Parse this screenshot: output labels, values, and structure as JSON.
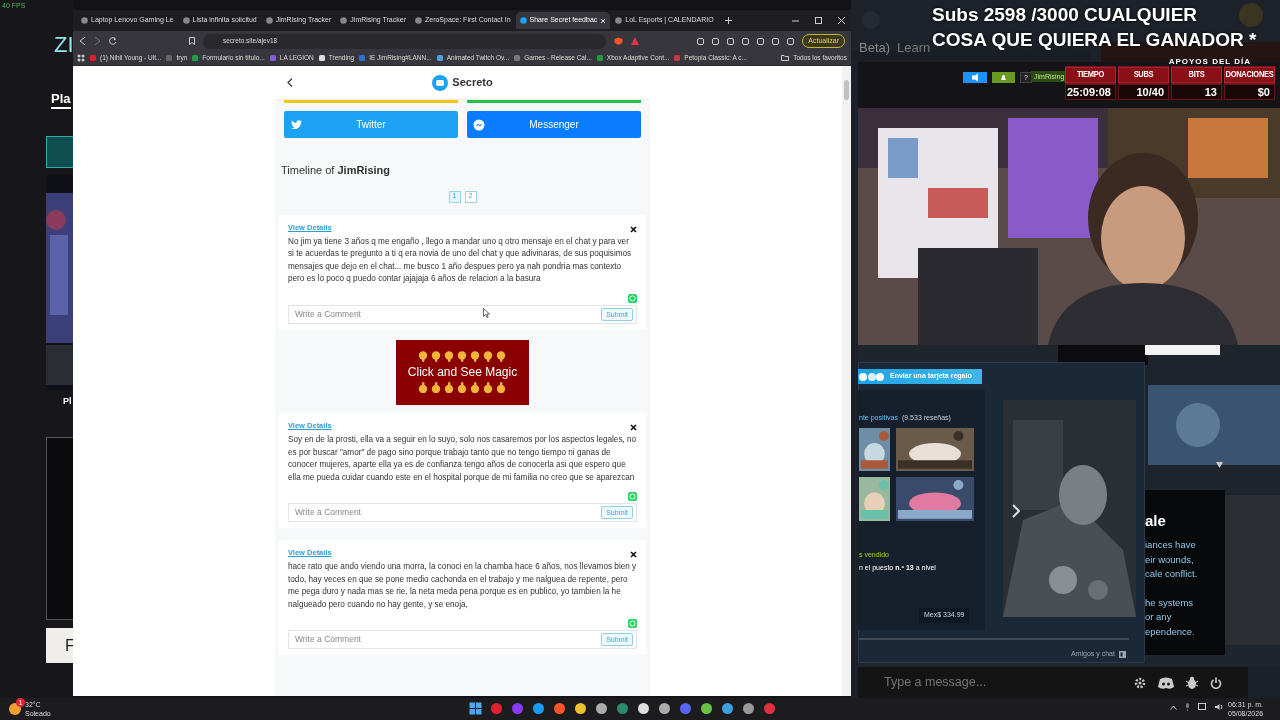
{
  "fps": "40 FPS",
  "background_app": {
    "logo": "ZI",
    "nav_item": "Pla",
    "card_title": "Pl",
    "button": "F"
  },
  "behind_overlay": {
    "beta_label": "Beta)",
    "learn_label": "Learn"
  },
  "browser": {
    "tabs": [
      {
        "title": "Laptop Lenovo Gaming Le",
        "selected": false
      },
      {
        "title": "Lista infinita solicitud",
        "selected": false
      },
      {
        "title": "JimRising Tracker",
        "selected": false
      },
      {
        "title": "JimRising Tracker",
        "selected": false
      },
      {
        "title": "ZeroSpace: First Contact In",
        "selected": false
      },
      {
        "title": "Share Secret feedbac",
        "selected": true
      },
      {
        "title": "LoL Esports | CALENDARIO",
        "selected": false
      }
    ],
    "url": "secreto.site/ajev18",
    "update_button": "Actualizar",
    "bookmarks": [
      "(1) Nihil Young - Ult...",
      "tryn",
      "Formulario sin título...",
      "LA LEGION",
      "Trending",
      "IE JimRising#LANN...",
      "Animated Twitch Ov...",
      "Games - Release Cal...",
      "Xbox Adaptive Cont...",
      "Petopia Classic: A c..."
    ],
    "all_bookmarks": "Todos los favoritos"
  },
  "page": {
    "title": "Secreto",
    "share_buttons": [
      {
        "kind": "twitter",
        "label": "Twitter"
      },
      {
        "kind": "messenger",
        "label": "Messenger"
      }
    ],
    "timeline_title": "Timeline of **JimRising**",
    "pages": [
      {
        "label": "1",
        "selected": true
      },
      {
        "label": "2",
        "selected": false
      }
    ],
    "posts": [
      {
        "link": "View Details",
        "message": "No jim ya tiene 3 años q me engaño , llego a mandar uno q otro mensaje en el chat y para ver si te acuerdas te pregunto a ti q era novia de uno del chat y que adivinaras, de sus poquisimos mensajes que dejo en el chat... me busco 1 año despues pero ya nah pondria mas contexto pero es lo poco q puedo contar jajajaja 6 años de relacion a la basura",
        "comment_placeholder": "Write a Comment",
        "submit": "Submit"
      },
      {
        "link": "View Details",
        "message": "Soy en de la prosti, ella va a seguir en lo suyo, solo nos casaremos por los aspectos legales, no es por buscar \"amor\" de pago sino porque trabajo tanto que no tengo tiempo ni ganas de conocer mujeres, aparte ella ya es de confianza tengo años de conocerla asi que espero que ella me pueda cuidar cuando este en el hospital porque de mi familia no creo que se aparezcan",
        "comment_placeholder": "Write a Comment",
        "submit": "Submit"
      },
      {
        "link": "View Details",
        "message": "hace rato que ando viendo una morra, la conoci en la chamba hace 6 años, nos llevamos bien y todo, hay veces en que se pone medio cachonda en el trabajo y me nalguea de repente, pero me pega duro y nada mas se rie, la neta meda pena porque es en publico, yo tambien la he nalgueado pero cuando no hay gente, y se enoja,",
        "comment_placeholder": "Write a Comment",
        "submit": "Submit"
      }
    ],
    "ad": "Click and See Magic"
  },
  "stream_overlay": {
    "goal_lines": [
      "Subs 2598 /3000 CUALQUIER",
      "COSA QUE QUIERA EL GANADOR *"
    ],
    "help": "?",
    "user_tag": "JimRising",
    "stats_title": "APOYOS DEL DÍA",
    "stats": [
      {
        "label": "TIEMPO",
        "value": "25:09:08"
      },
      {
        "label": "SUBS",
        "value": "10/40"
      },
      {
        "label": "BITS",
        "value": "13"
      },
      {
        "label": "DONACIONES",
        "value": "$0"
      }
    ]
  },
  "steam": {
    "gift_button": "Enviar una tarjeta regalo",
    "reviews_label": "nte positivas",
    "reviews_count": "(9.533 reseñas)",
    "sales_label": "s vendido",
    "rank": "n el puesto **n.º 13** a nivel",
    "price": "Mex$ 334.99",
    "friends": "Amigos y chat"
  },
  "game_panel": {
    "heading": "ale",
    "lines": [
      "iances have",
      "eir wounds,",
      "cale conflict.",
      "he systems",
      "or any",
      "ependence."
    ]
  },
  "chat": {
    "placeholder": "Type a message..."
  },
  "taskbar": {
    "weather_badge": "1",
    "temperature": "32°C",
    "weather": "Soleado",
    "time": "06:31 p. m.",
    "date": "05/08/2026"
  }
}
